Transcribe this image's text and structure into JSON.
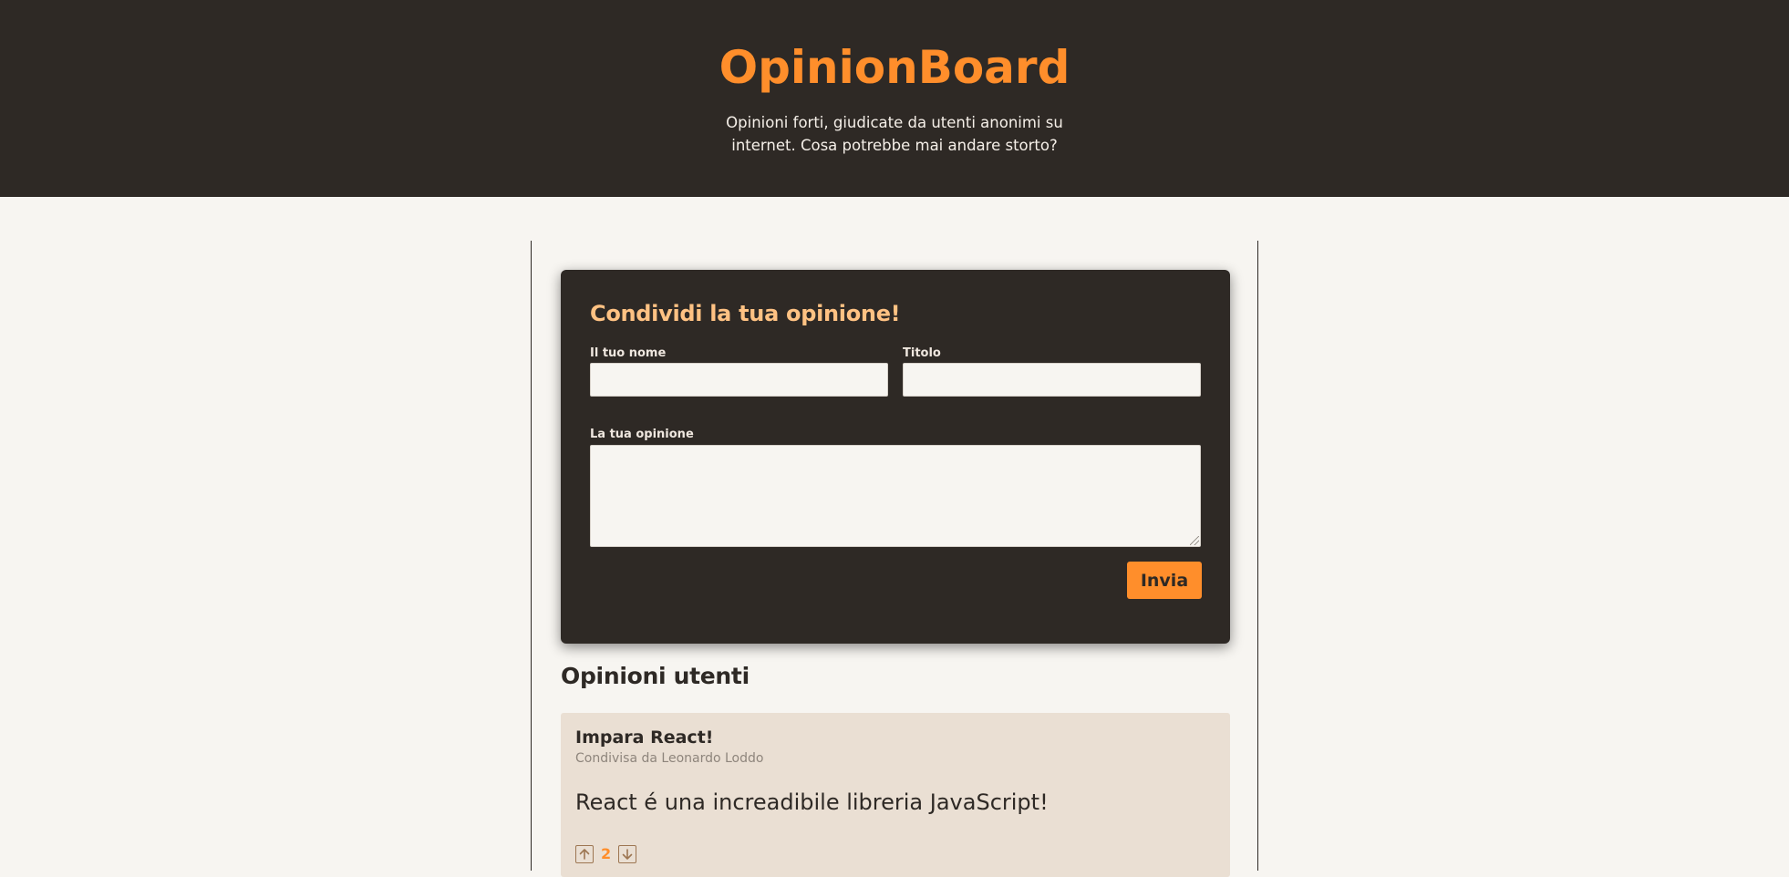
{
  "header": {
    "brand": "OpinionBoard",
    "tagline": "Opinioni forti, giudicate da utenti anonimi su internet. Cosa potrebbe mai andare storto?"
  },
  "form": {
    "title": "Condividi la tua opinione!",
    "name_label": "Il tuo nome",
    "name_value": "",
    "title_label": "Titolo",
    "title_value": "",
    "opinion_label": "La tua opinione",
    "opinion_value": "",
    "submit_label": "Invia"
  },
  "opinions": {
    "section_title": "Opinioni utenti",
    "items": [
      {
        "title": "Impara React!",
        "author": "Condivisa da Leonardo Loddo",
        "body": "React é una increadibile libreria JavaScript!",
        "votes": "2"
      }
    ]
  },
  "colors": {
    "accent": "#ff8e2b",
    "form_title": "#ffc283",
    "dark": "#2e2925",
    "card": "#eadfd3",
    "page_bg": "#f7f5f1"
  },
  "icons": {
    "upvote": "arrow-up-icon",
    "downvote": "arrow-down-icon"
  }
}
